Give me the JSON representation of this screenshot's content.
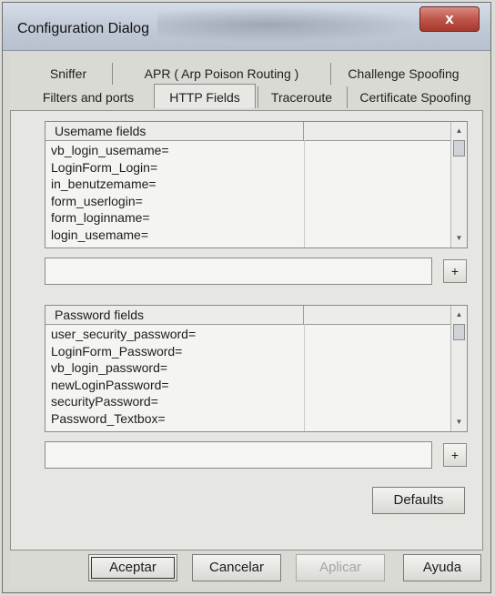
{
  "window": {
    "title": "Configuration Dialog",
    "close_label": "x"
  },
  "tabs": {
    "back_row": [
      "Sniffer",
      "APR ( Arp Poison Routing )",
      "Challenge Spoofing"
    ],
    "front_row": [
      "Filters and ports",
      "HTTP Fields",
      "Traceroute",
      "Certificate Spoofing"
    ],
    "active": "HTTP Fields"
  },
  "username_group": {
    "column_header": "Usemame fields",
    "items": [
      "vb_login_usemame=",
      "LoginForm_Login=",
      "in_benutzemame=",
      "form_userlogin=",
      "form_loginname=",
      "login_usemame="
    ],
    "entry_value": "",
    "add_label": "+"
  },
  "password_group": {
    "column_header": "Password fields",
    "items": [
      "user_security_password=",
      "LoginForm_Password=",
      "vb_login_password=",
      "newLoginPassword=",
      "securityPassword=",
      "Password_Textbox="
    ],
    "entry_value": "",
    "add_label": "+"
  },
  "buttons": {
    "defaults": "Defaults",
    "accept": "Aceptar",
    "cancel": "Cancelar",
    "apply": "Aplicar",
    "help": "Ayuda"
  }
}
